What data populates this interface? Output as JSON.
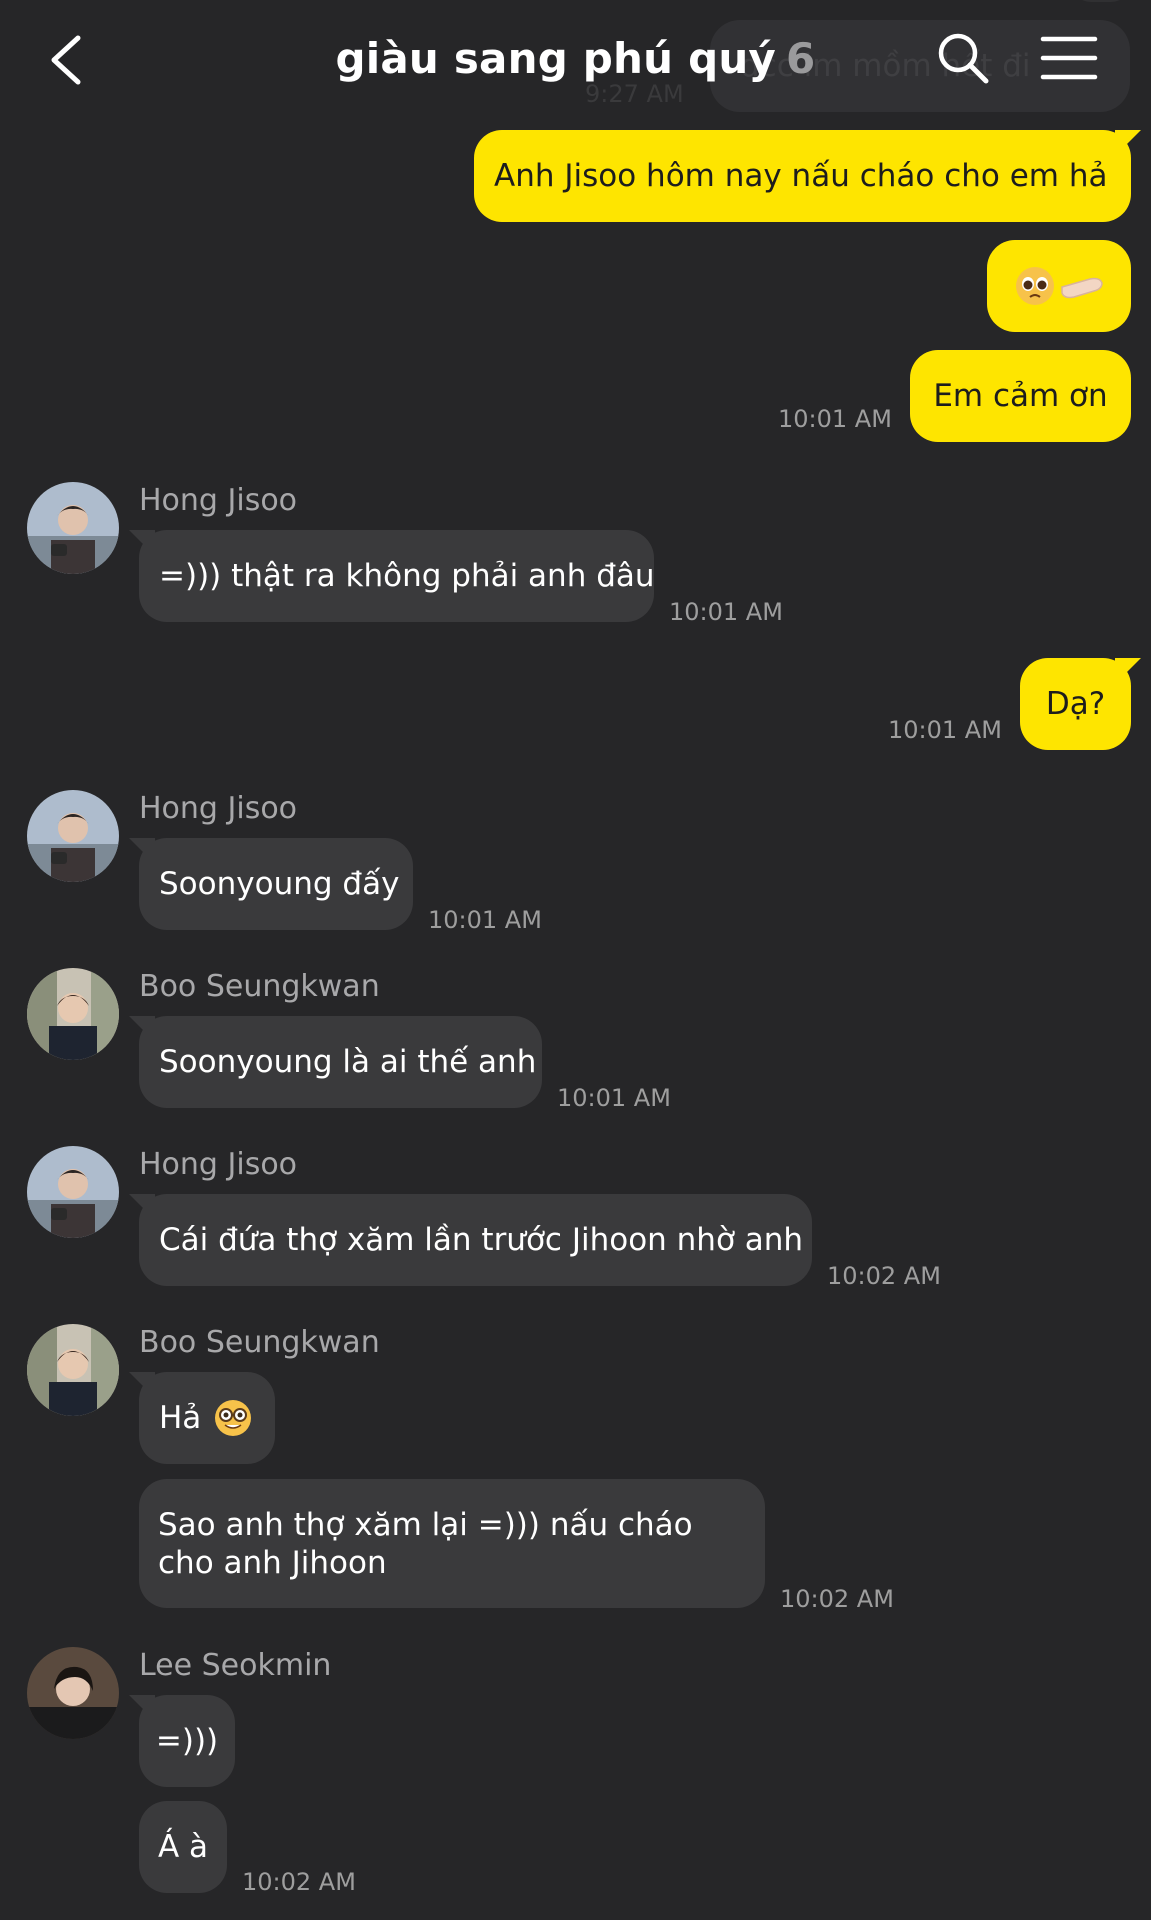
{
  "header": {
    "title": "giàu sang phú quý",
    "member_count": "6"
  },
  "ghost": {
    "text": "dcc im mồm hết đi",
    "time": "9:27 AM"
  },
  "messages": {
    "m1": {
      "text": "Anh Jisoo hôm nay nấu cháo cho em hả"
    },
    "m2": {
      "emoji": "pleading-face-and-hand"
    },
    "m3": {
      "text": "Em cảm ơn",
      "time": "10:01 AM"
    },
    "m4": {
      "sender": "Hong Jisoo",
      "text": "=))) thật ra không phải anh đâu",
      "time": "10:01 AM"
    },
    "m5": {
      "text": "Dạ?",
      "time": "10:01 AM"
    },
    "m6": {
      "sender": "Hong Jisoo",
      "text": "Soonyoung đấy",
      "time": "10:01 AM"
    },
    "m7": {
      "sender": "Boo Seungkwan",
      "text": "Soonyoung là ai thế anh",
      "time": "10:01 AM"
    },
    "m8": {
      "sender": "Hong Jisoo",
      "text": "Cái đứa thợ xăm lần trước Jihoon nhờ anh",
      "time": "10:02 AM"
    },
    "m9": {
      "sender": "Boo Seungkwan",
      "text": "Hả",
      "emoji": "nerd-face"
    },
    "m10": {
      "text": "Sao anh thợ xăm lại =))) nấu cháo cho anh Jihoon",
      "time": "10:02 AM"
    },
    "m11": {
      "sender": "Lee Seokmin",
      "text": "=)))"
    },
    "m12": {
      "text": "Á à",
      "time": "10:02 AM"
    }
  },
  "colors": {
    "background": "#262628",
    "my_bubble": "#fee500",
    "other_bubble": "#3a3a3c"
  }
}
